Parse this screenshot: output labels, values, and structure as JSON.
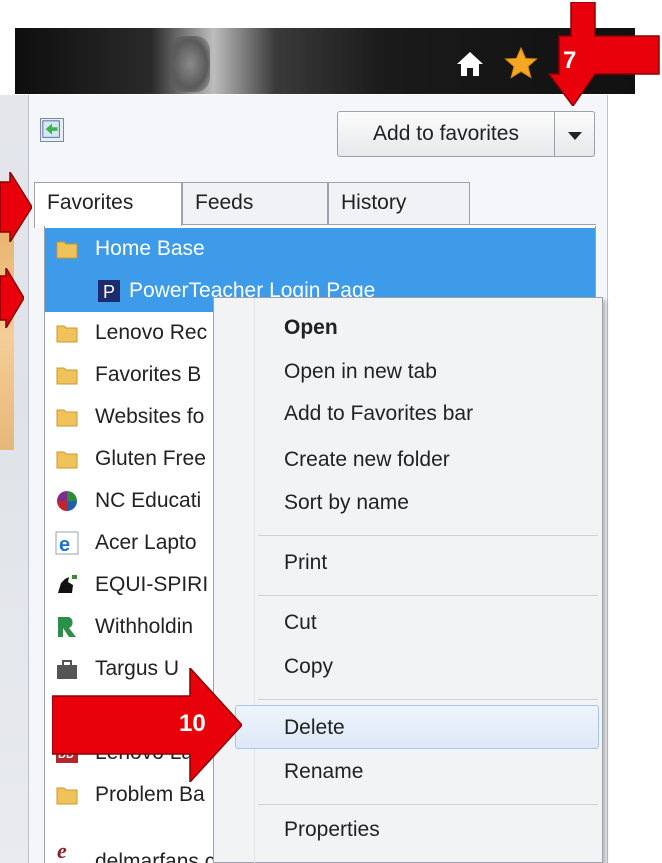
{
  "toolbar": {
    "add_to_favorites_label": "Add to favorites"
  },
  "tabs": [
    {
      "label": "Favorites",
      "active": true
    },
    {
      "label": "Feeds",
      "active": false
    },
    {
      "label": "History",
      "active": false
    }
  ],
  "favorites": [
    {
      "label": "Home Base",
      "icon": "folder-icon",
      "selected": true
    },
    {
      "label": "PowerTeacher Login Page",
      "icon": "powerteacher-icon",
      "selected": true,
      "indent": true
    },
    {
      "label": "Lenovo Rec",
      "icon": "folder-icon"
    },
    {
      "label": "Favorites B",
      "icon": "folder-icon"
    },
    {
      "label": "Websites fo",
      "icon": "folder-icon"
    },
    {
      "label": "Gluten Free",
      "icon": "folder-icon"
    },
    {
      "label": "NC Educati",
      "icon": "globe-icon"
    },
    {
      "label": "Acer Lapto",
      "icon": "ie-icon"
    },
    {
      "label": "EQUI-SPIRI",
      "icon": "horse-icon"
    },
    {
      "label": "Withholdin",
      "icon": "r-icon"
    },
    {
      "label": "Targus U",
      "icon": "briefcase-icon"
    },
    {
      "label": "",
      "icon": "page-icon"
    },
    {
      "label": "Lenovo Lar",
      "icon": "lenovo-icon"
    },
    {
      "label": "Problem Ba",
      "icon": "folder-icon"
    },
    {
      "label": "delmarfans.com/...",
      "icon": "ie-icon"
    }
  ],
  "context_menu": [
    {
      "label": "Open",
      "bold": true
    },
    {
      "label": "Open in new tab"
    },
    {
      "label": "Add to Favorites bar"
    },
    {
      "label": "Create new folder"
    },
    {
      "label": "Sort by name"
    },
    {
      "label": "Print"
    },
    {
      "label": "Cut"
    },
    {
      "label": "Copy"
    },
    {
      "label": "Delete",
      "highlighted": true
    },
    {
      "label": "Rename"
    },
    {
      "label": "Properties"
    }
  ],
  "callouts": {
    "arrow_7": "7",
    "arrow_10": "10"
  },
  "colors": {
    "selection": "#3d9be9",
    "arrow_red": "#e8000b",
    "star": "#f5a623"
  }
}
